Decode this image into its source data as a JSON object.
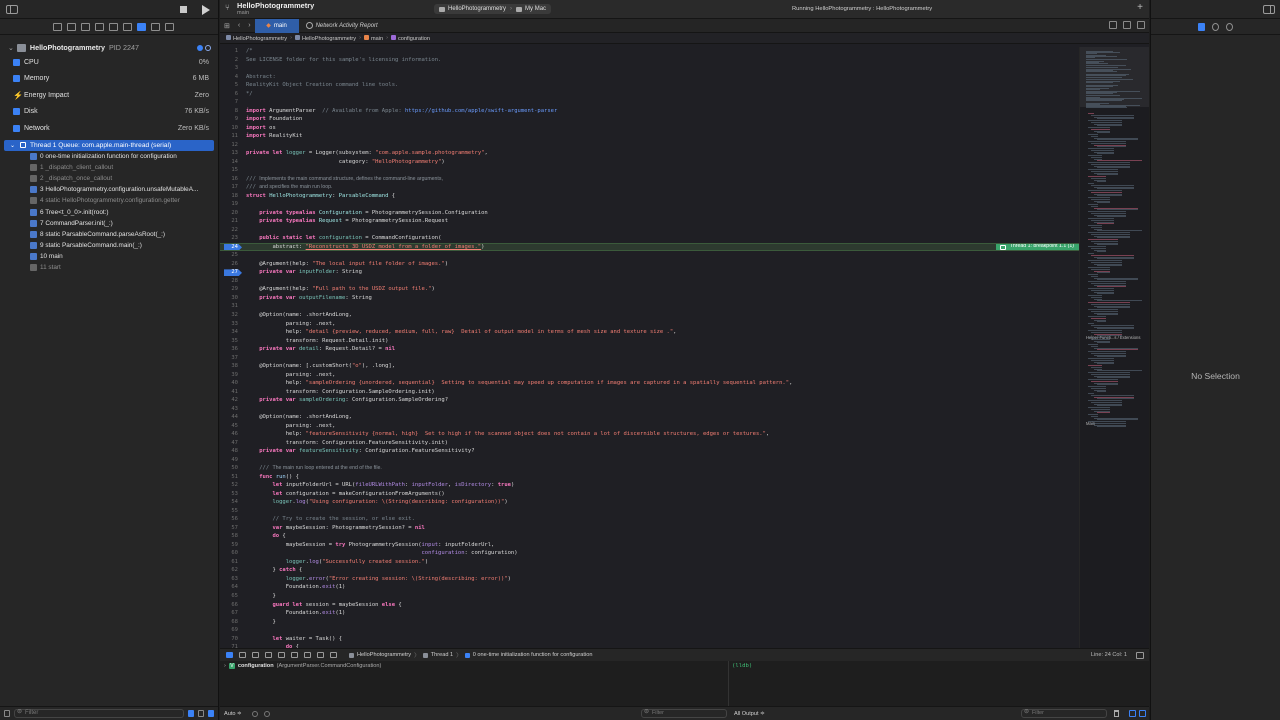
{
  "navigator": {
    "process": {
      "name": "HelloPhotogrammetry",
      "pid": "PID 2247"
    },
    "gauges": [
      {
        "label": "CPU",
        "value": "0%",
        "icon": "cpu-gauge-icon"
      },
      {
        "label": "Memory",
        "value": "6 MB",
        "icon": "memory-gauge-icon"
      },
      {
        "label": "Energy Impact",
        "value": "Zero",
        "icon": "energy-gauge-icon"
      },
      {
        "label": "Disk",
        "value": "76 KB/s",
        "icon": "disk-gauge-icon"
      },
      {
        "label": "Network",
        "value": "Zero KB/s",
        "icon": "network-gauge-icon"
      }
    ],
    "thread": {
      "label": "Thread 1 Queue: com.apple.main-thread (serial)"
    },
    "frames": [
      {
        "label": "0 one-time initialization function for configuration",
        "dim": false
      },
      {
        "label": "1 _dispatch_client_callout",
        "dim": true
      },
      {
        "label": "2 _dispatch_once_callout",
        "dim": true
      },
      {
        "label": "3 HelloPhotogrammetry.configuration.unsafeMutableA...",
        "dim": false
      },
      {
        "label": "4 static HelloPhotogrammetry.configuration.getter",
        "dim": true
      },
      {
        "label": "6 Tree<t_0_0>.init(root:)",
        "dim": false
      },
      {
        "label": "7 CommandParser.init(_:)",
        "dim": false
      },
      {
        "label": "8 static ParsableCommand.parseAsRoot(_:)",
        "dim": false
      },
      {
        "label": "9 static ParsableCommand.main(_:)",
        "dim": false
      },
      {
        "label": "10 main",
        "dim": false
      },
      {
        "label": "11 start",
        "dim": true
      }
    ],
    "filter_placeholder": "Filter"
  },
  "titlebar": {
    "project": "HelloPhotogrammetry",
    "branch": "main",
    "scheme": "HelloPhotogrammetry",
    "destination": "My Mac",
    "status": "Running HelloPhotogrammetry : HelloPhotogrammetry"
  },
  "tabs": [
    {
      "label": "main",
      "active": true,
      "icon": "swift-file-icon"
    },
    {
      "label": "Network Activity Report",
      "active": false,
      "icon": "network-report-icon"
    }
  ],
  "jumpbar": [
    "HelloPhotogrammetry",
    "HelloPhotogrammetry",
    "main",
    "configuration"
  ],
  "breakpoint_label": "Thread 1: breakpoint 1.1 (1)",
  "minimap": {
    "labels": [
      "Helper Functi...s / Extensions",
      "Main"
    ]
  },
  "debugbar": {
    "crumbs": [
      "HelloPhotogrammetry",
      "Thread 1",
      "0 one-time initialization function for configuration"
    ],
    "position": "Line: 24  Col: 1"
  },
  "variables": [
    {
      "name": "configuration",
      "type": "(ArgumentParser.CommandConfiguration)"
    }
  ],
  "console_output": "(lldb)",
  "debug_bottom": {
    "auto": "Auto ≑",
    "filter_left": "Filter",
    "all_output": "All Output ≑",
    "filter_right": "Filter"
  },
  "inspector": {
    "empty_label": "No Selection"
  },
  "colors": {
    "accent": "#2a64c8",
    "breakpoint": "#3a78e0",
    "current_line": "#39a46b"
  }
}
